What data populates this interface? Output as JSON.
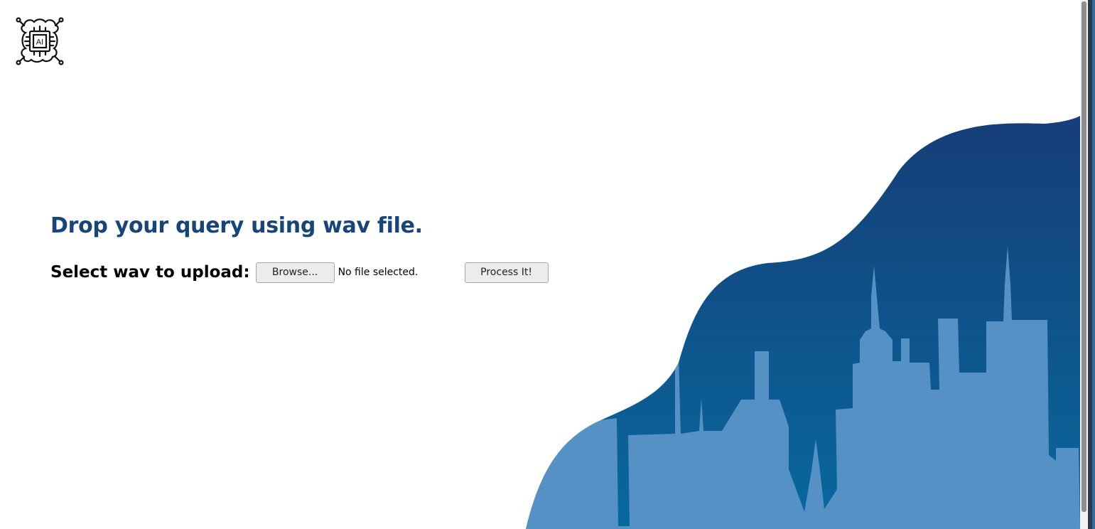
{
  "logo": {
    "icon": "ai-chip-icon",
    "text": "AI"
  },
  "heading": "Drop your query using wav file.",
  "upload": {
    "label": "Select wav to upload:",
    "browse_label": "Browse...",
    "file_status": "No file selected.",
    "submit_label": "Process It!"
  },
  "colors": {
    "heading": "#17457a",
    "wave_top": "#153f78",
    "wave_bottom": "#0a69a0",
    "skyline": "#5591c4"
  }
}
